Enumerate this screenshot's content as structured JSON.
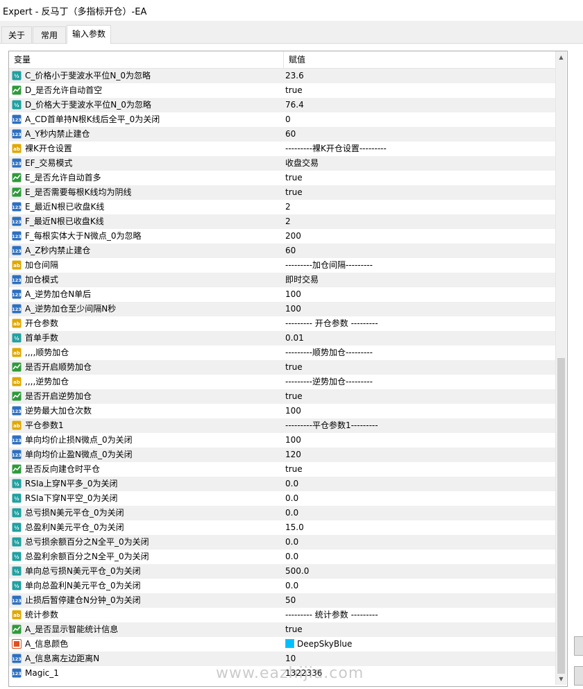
{
  "window": {
    "title": "Expert - 反马丁（多指标开仓）-EA"
  },
  "tabs": [
    {
      "label": "关于",
      "active": false
    },
    {
      "label": "常用",
      "active": false
    },
    {
      "label": "输入参数",
      "active": true
    }
  ],
  "grid": {
    "headers": {
      "variable": "变量",
      "value": "赋值"
    },
    "rows": [
      {
        "icon": "double-icon",
        "name": "C_价格小于斐波水平位N_0为忽略",
        "value": "23.6"
      },
      {
        "icon": "bool-icon",
        "name": "D_是否允许自动首空",
        "value": "true"
      },
      {
        "icon": "double-icon",
        "name": "D_价格大于斐波水平位N_0为忽略",
        "value": "76.4"
      },
      {
        "icon": "int-icon",
        "name": "A_CD首单持N根K线后全平_0为关闭",
        "value": "0"
      },
      {
        "icon": "int-icon",
        "name": "A_Y秒内禁止建仓",
        "value": "60"
      },
      {
        "icon": "string-icon",
        "name": "裸K开仓设置",
        "value": "---------裸K开仓设置---------"
      },
      {
        "icon": "int-icon",
        "name": "EF_交易模式",
        "value": "收盘交易"
      },
      {
        "icon": "bool-icon",
        "name": "E_是否允许自动首多",
        "value": "true"
      },
      {
        "icon": "bool-icon",
        "name": "E_是否需要每根K线均为阴线",
        "value": "true"
      },
      {
        "icon": "int-icon",
        "name": "E_最近N根已收盘K线",
        "value": "2"
      },
      {
        "icon": "int-icon",
        "name": "F_最近N根已收盘K线",
        "value": "2"
      },
      {
        "icon": "int-icon",
        "name": "F_每根实体大于N微点_0为忽略",
        "value": "200"
      },
      {
        "icon": "int-icon",
        "name": "A_Z秒内禁止建仓",
        "value": "60"
      },
      {
        "icon": "string-icon",
        "name": "加仓间隔",
        "value": "---------加仓间隔---------"
      },
      {
        "icon": "int-icon",
        "name": "加仓模式",
        "value": "即时交易"
      },
      {
        "icon": "int-icon",
        "name": "A_逆势加仓N单后",
        "value": "100"
      },
      {
        "icon": "int-icon",
        "name": "A_逆势加仓至少间隔N秒",
        "value": "100"
      },
      {
        "icon": "string-icon",
        "name": "开仓参数",
        "value": "--------- 开仓参数 ---------"
      },
      {
        "icon": "double-icon",
        "name": "首单手数",
        "value": "0.01"
      },
      {
        "icon": "string-icon",
        "name": ",,,,顺势加仓",
        "value": "---------顺势加仓---------"
      },
      {
        "icon": "bool-icon",
        "name": "是否开启顺势加仓",
        "value": "true"
      },
      {
        "icon": "string-icon",
        "name": ",,,,逆势加仓",
        "value": "---------逆势加仓---------"
      },
      {
        "icon": "bool-icon",
        "name": "是否开启逆势加仓",
        "value": "true"
      },
      {
        "icon": "int-icon",
        "name": "逆势最大加仓次数",
        "value": "100"
      },
      {
        "icon": "string-icon",
        "name": "平仓参数1",
        "value": "---------平仓参数1---------"
      },
      {
        "icon": "int-icon",
        "name": "单向均价止损N微点_0为关闭",
        "value": "100"
      },
      {
        "icon": "int-icon",
        "name": "单向均价止盈N微点_0为关闭",
        "value": "120"
      },
      {
        "icon": "bool-icon",
        "name": "是否反向建仓时平仓",
        "value": "true"
      },
      {
        "icon": "double-icon",
        "name": "RSIa上穿N平多_0为关闭",
        "value": "0.0"
      },
      {
        "icon": "double-icon",
        "name": "RSIa下穿N平空_0为关闭",
        "value": "0.0"
      },
      {
        "icon": "double-icon",
        "name": "总亏损N美元平仓_0为关闭",
        "value": "0.0"
      },
      {
        "icon": "double-icon",
        "name": "总盈利N美元平仓_0为关闭",
        "value": "15.0"
      },
      {
        "icon": "double-icon",
        "name": "总亏损余额百分之N全平_0为关闭",
        "value": "0.0"
      },
      {
        "icon": "double-icon",
        "name": "总盈利余额百分之N全平_0为关闭",
        "value": "0.0"
      },
      {
        "icon": "double-icon",
        "name": "单向总亏损N美元平仓_0为关闭",
        "value": "500.0"
      },
      {
        "icon": "double-icon",
        "name": "单向总盈利N美元平仓_0为关闭",
        "value": "0.0"
      },
      {
        "icon": "int-icon",
        "name": "止损后暂停建仓N分钟_0为关闭",
        "value": "50"
      },
      {
        "icon": "string-icon",
        "name": "统计参数",
        "value": "--------- 统计参数 ---------"
      },
      {
        "icon": "bool-icon",
        "name": "A_是否显示智能统计信息",
        "value": "true"
      },
      {
        "icon": "color-icon",
        "name": "A_信息颜色",
        "value": "DeepSkyBlue",
        "swatch": "#00bfff"
      },
      {
        "icon": "int-icon",
        "name": "A_信息离左边距离N",
        "value": "10"
      },
      {
        "icon": "int-icon",
        "name": "Magic_1",
        "value": "1322336"
      }
    ]
  },
  "watermark": "www.eazhijia.com",
  "colors": {
    "row_alt": "#f0f0f0",
    "int_icon": "#2d6fc0",
    "double_icon": "#20a0a0",
    "bool_icon": "#2e9a3a",
    "string_icon": "#e0a800",
    "color_icon": "#e05020"
  }
}
